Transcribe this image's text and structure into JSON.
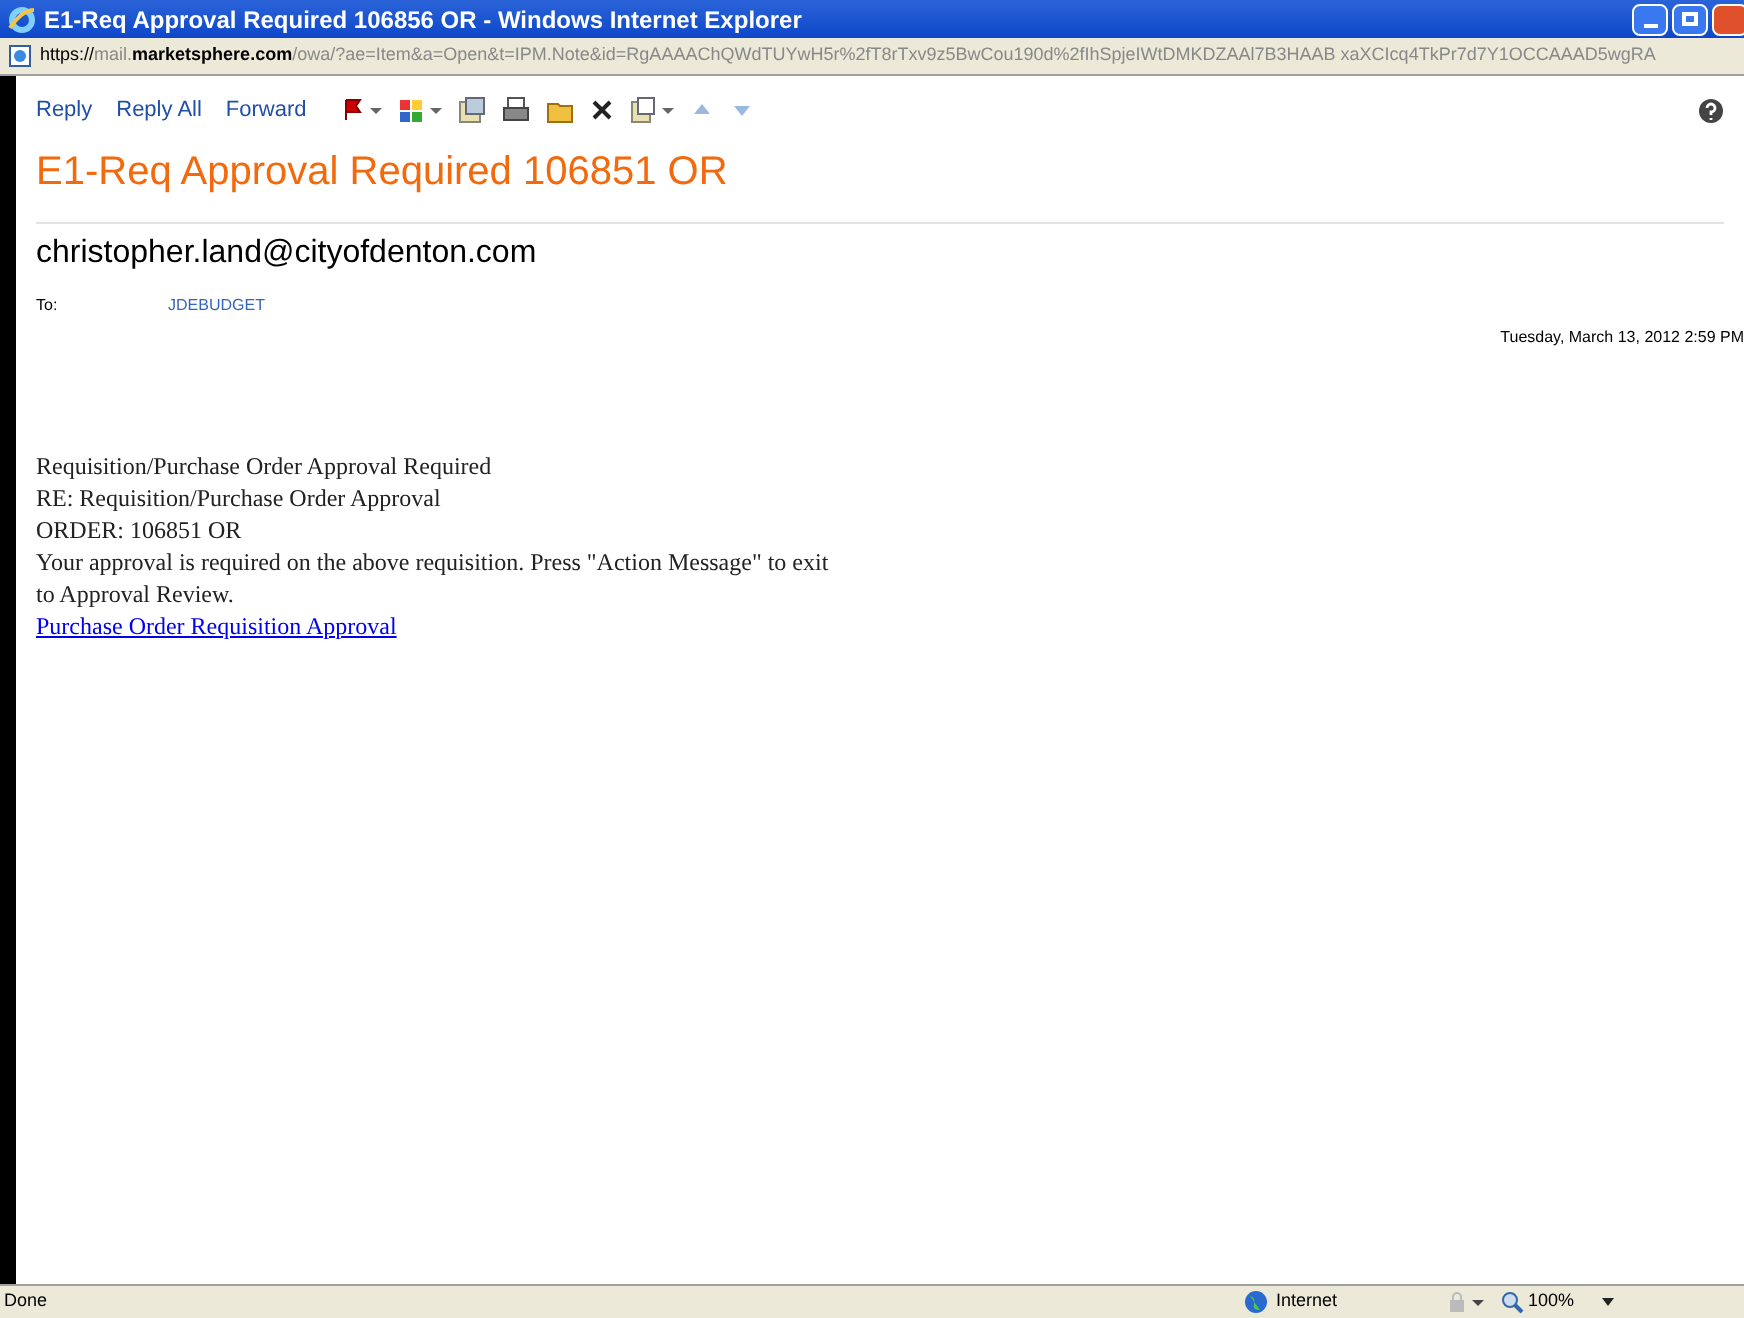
{
  "window": {
    "title": "E1-Req Approval Required 106856 OR - Windows Internet Explorer"
  },
  "address": {
    "scheme": "https://",
    "host_prefix": "mail.",
    "host": "marketsphere.com",
    "path": "/owa/?ae=Item&a=Open&t=IPM.Note&id=RgAAAAChQWdTUYwH5r%2fT8rTxv9z5BwCou190d%2fIhSpjeIWtDMKDZAAl7B3HAAB xaXCIcq4TkPr7d7Y1OCCAAAD5wgRA"
  },
  "toolbar": {
    "actions": [
      "Reply",
      "Reply All",
      "Forward"
    ]
  },
  "message": {
    "subject": "E1-Req Approval Required 106851 OR",
    "from": "christopher.land@cityofdenton.com",
    "to_label": "To:",
    "to": "JDEBUDGET",
    "date": "Tuesday, March 13, 2012 2:59 PM",
    "body": [
      "Requisition/Purchase Order Approval Required",
      "RE: Requisition/Purchase Order Approval",
      "ORDER: 106851 OR",
      "Your approval is required on the above requisition. Press \"Action Message\" to exit to Approval Review."
    ],
    "link": "Purchase Order Requisition Approval"
  },
  "status_bar": {
    "text": "Done",
    "zone": "Internet",
    "zoom": "100%"
  }
}
